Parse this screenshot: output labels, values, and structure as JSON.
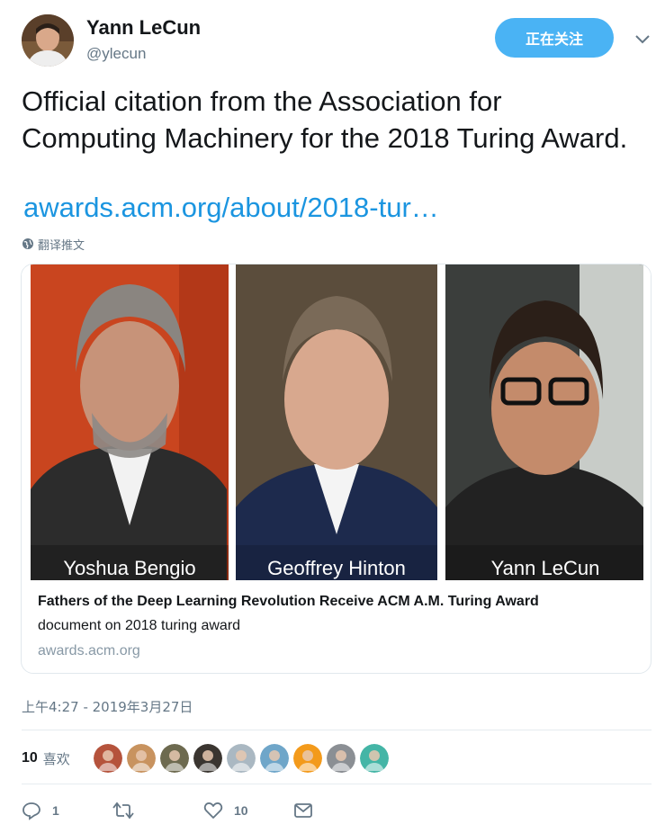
{
  "author": {
    "name": "Yann LeCun",
    "handle": "@ylecun",
    "avatar_icon": "profile-photo"
  },
  "follow_button": {
    "label": "正在关注"
  },
  "more_menu_icon": "chevron-down-icon",
  "tweet": {
    "text": "Official citation from the Association for Computing Machinery for the 2018 Turing Award.",
    "link": "awards.acm.org/about/2018-tur…",
    "translate_label": "翻译推文",
    "timestamp": "上午4:27 - 2019年3月27日"
  },
  "card": {
    "image_captions": [
      "Yoshua Bengio",
      "Geoffrey Hinton",
      "Yann LeCun"
    ],
    "title": "Fathers of the Deep Learning Revolution Receive ACM A.M. Turing Award",
    "description": "document on 2018 turing award",
    "domain": "awards.acm.org"
  },
  "likes": {
    "count": "10",
    "label": "喜欢",
    "likers": [
      {
        "color": "#b5533c"
      },
      {
        "color": "#c8935f"
      },
      {
        "color": "#6d6a4f"
      },
      {
        "color": "#3a3530"
      },
      {
        "color": "#aab8c2"
      },
      {
        "color": "#6fa6c9"
      },
      {
        "color": "#f39a1b"
      },
      {
        "color": "#8b8f94"
      },
      {
        "color": "#44b5a6"
      }
    ]
  },
  "actions": {
    "reply_count": "1",
    "retweet_count": "",
    "like_count": "10"
  },
  "colors": {
    "accent": "#1b95e0",
    "follow_button_bg": "#4ab3f4",
    "muted_text": "#657786"
  }
}
